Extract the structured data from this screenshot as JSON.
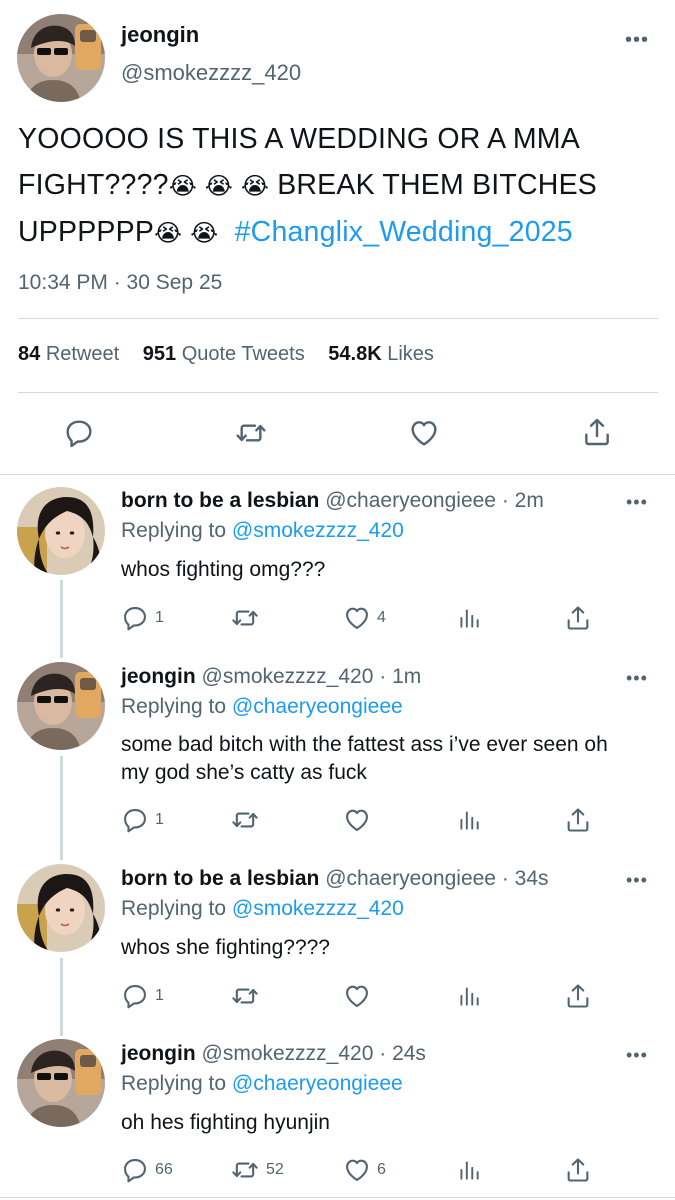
{
  "main_tweet": {
    "name": "jeongin",
    "handle": "@smokezzzz_420",
    "text_part1": "YOOOOO IS THIS A WEDDING OR A MMA FIGHT????",
    "emoji1": "😭 😭 😭",
    "text_part2": " BREAK THEM BITCHES UPPPPPP",
    "emoji2": "😭 😭",
    "hashtag": "#Changlix_Wedding_2025",
    "timestamp": "10:34 PM · 30 Sep 25",
    "retweet_count": "84",
    "retweet_label": "Retweet",
    "quote_count": "951",
    "quote_label": "Quote Tweets",
    "like_count": "54.8K",
    "like_label": "Likes"
  },
  "replies": [
    {
      "name": "born to be a lesbian",
      "handle_time": "@chaeryeongieee · 2m",
      "replying_label": "Replying to",
      "replying_to": "@smokezzzz_420",
      "text": "whos fighting omg???",
      "reply_count": "1",
      "retweet_count": "",
      "like_count": "4"
    },
    {
      "name": "jeongin",
      "handle_time": "@smokezzzz_420 · 1m",
      "replying_label": "Replying to",
      "replying_to": "@chaeryeongieee",
      "text": "some bad bitch with the fattest ass i’ve ever seen oh my god she’s catty as fuck",
      "reply_count": "1",
      "retweet_count": "",
      "like_count": ""
    },
    {
      "name": "born to be a lesbian",
      "handle_time": "@chaeryeongieee · 34s",
      "replying_label": "Replying to",
      "replying_to": "@smokezzzz_420",
      "text": "whos she fighting????",
      "reply_count": "1",
      "retweet_count": "",
      "like_count": ""
    },
    {
      "name": "jeongin",
      "handle_time": "@smokezzzz_420 · 24s",
      "replying_label": "Replying to",
      "replying_to": "@chaeryeongieee",
      "text": "oh hes fighting hyunjin",
      "reply_count": "66",
      "retweet_count": "52",
      "like_count": "6"
    }
  ],
  "more_glyph": "•••",
  "colors": {
    "link": "#1d9bf0",
    "secondary": "#536471",
    "divider": "#cfd9de"
  },
  "icons": [
    "reply-icon",
    "retweet-icon",
    "like-icon",
    "share-icon",
    "analytics-icon",
    "more-icon"
  ]
}
